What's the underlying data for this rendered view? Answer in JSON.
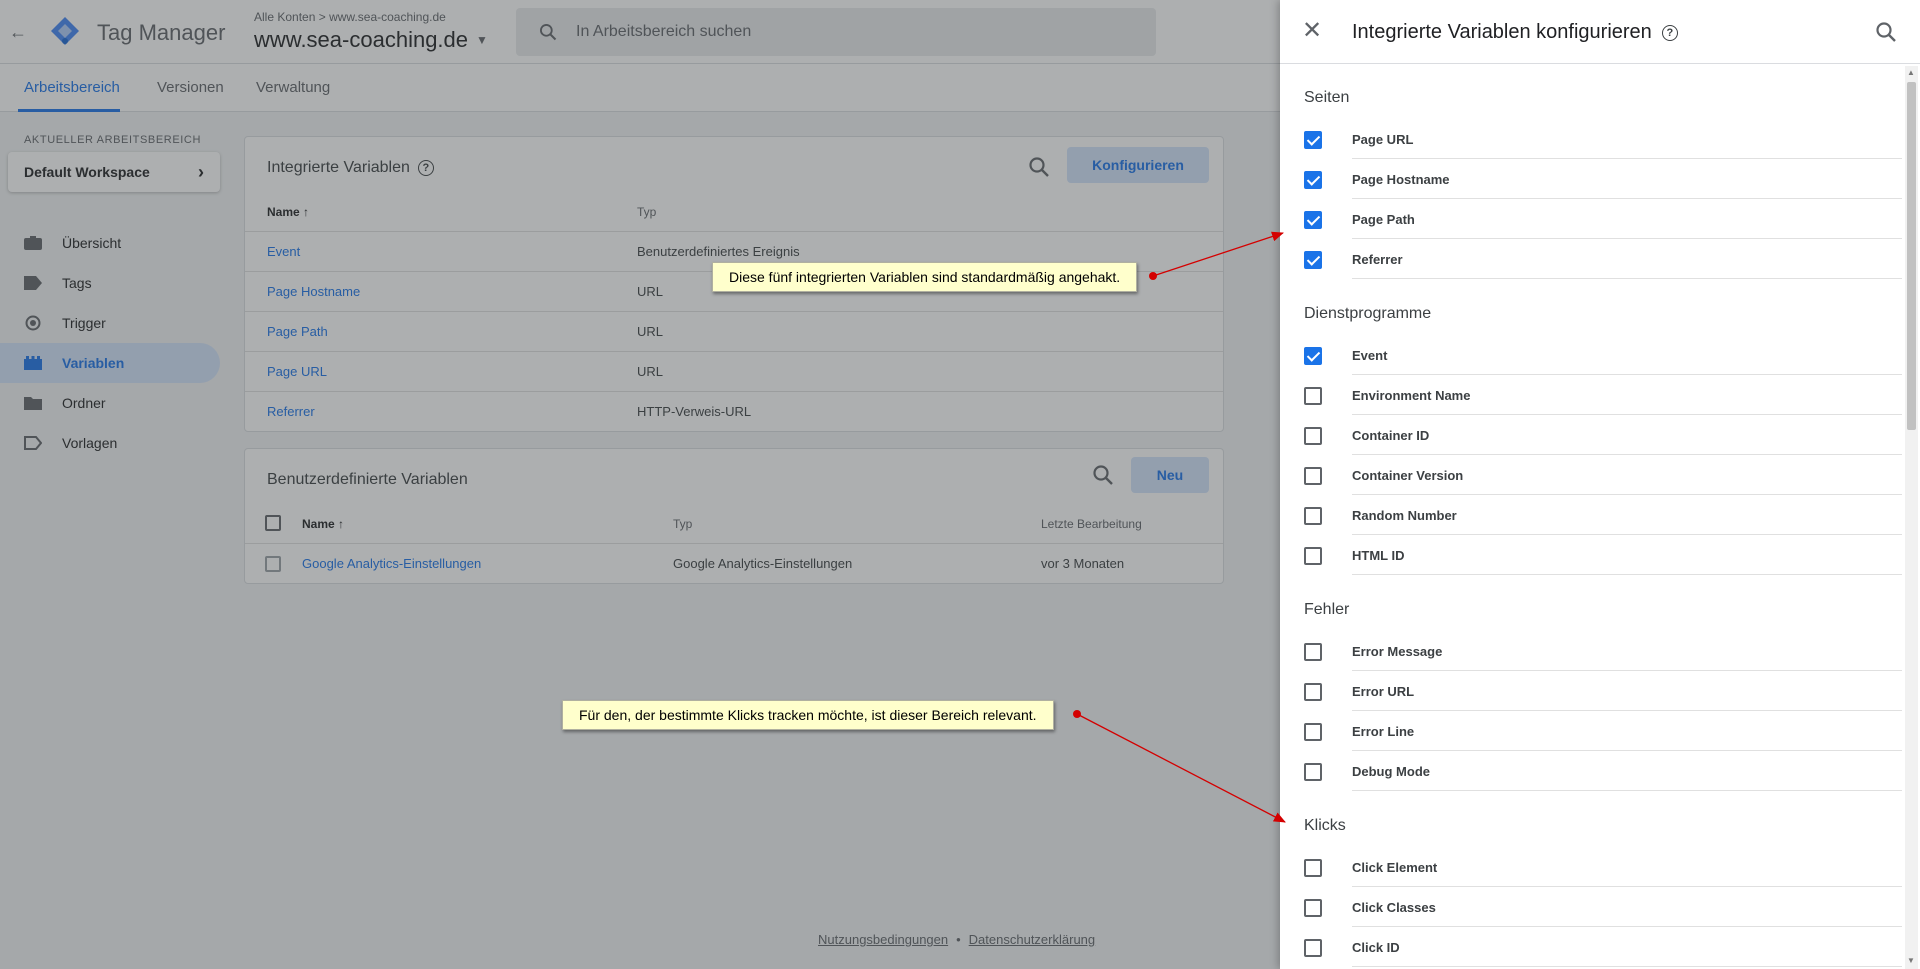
{
  "app": {
    "product": "Tag Manager",
    "breadcrumb_account": "Alle Konten",
    "breadcrumb_sep": ">",
    "breadcrumb_container": "www.sea-coaching.de",
    "container_name": "www.sea-coaching.de",
    "search_placeholder": "In Arbeitsbereich suchen"
  },
  "tabs": [
    "Arbeitsbereich",
    "Versionen",
    "Verwaltung"
  ],
  "workspace": {
    "label": "AKTUELLER ARBEITSBEREICH",
    "name": "Default Workspace"
  },
  "sidebar": {
    "items": [
      {
        "label": "Übersicht",
        "icon": "briefcase-icon"
      },
      {
        "label": "Tags",
        "icon": "tag-icon"
      },
      {
        "label": "Trigger",
        "icon": "trigger-icon"
      },
      {
        "label": "Variablen",
        "icon": "variables-icon",
        "active": true
      },
      {
        "label": "Ordner",
        "icon": "folder-icon"
      },
      {
        "label": "Vorlagen",
        "icon": "template-icon"
      }
    ]
  },
  "builtin": {
    "title": "Integrierte Variablen",
    "configure_label": "Konfigurieren",
    "col_name": "Name",
    "col_type": "Typ",
    "rows": [
      {
        "name": "Event",
        "type": "Benutzerdefiniertes Ereignis"
      },
      {
        "name": "Page Hostname",
        "type": "URL"
      },
      {
        "name": "Page Path",
        "type": "URL"
      },
      {
        "name": "Page URL",
        "type": "URL"
      },
      {
        "name": "Referrer",
        "type": "HTTP-Verweis-URL"
      }
    ]
  },
  "custom": {
    "title": "Benutzerdefinierte Variablen",
    "new_label": "Neu",
    "col_name": "Name",
    "col_type": "Typ",
    "col_edit": "Letzte Bearbeitung",
    "rows": [
      {
        "name": "Google Analytics-Einstellungen",
        "type": "Google Analytics-Einstellungen",
        "edited": "vor 3 Monaten"
      }
    ]
  },
  "footer": {
    "terms": "Nutzungsbedingungen",
    "sep": "•",
    "privacy": "Datenschutzerklärung"
  },
  "panel": {
    "title": "Integrierte Variablen konfigurieren",
    "sections": [
      {
        "title": "Seiten",
        "options": [
          {
            "label": "Page URL",
            "checked": true
          },
          {
            "label": "Page Hostname",
            "checked": true
          },
          {
            "label": "Page Path",
            "checked": true
          },
          {
            "label": "Referrer",
            "checked": true
          }
        ]
      },
      {
        "title": "Dienstprogramme",
        "options": [
          {
            "label": "Event",
            "checked": true
          },
          {
            "label": "Environment Name",
            "checked": false
          },
          {
            "label": "Container ID",
            "checked": false
          },
          {
            "label": "Container Version",
            "checked": false
          },
          {
            "label": "Random Number",
            "checked": false
          },
          {
            "label": "HTML ID",
            "checked": false
          }
        ]
      },
      {
        "title": "Fehler",
        "options": [
          {
            "label": "Error Message",
            "checked": false
          },
          {
            "label": "Error URL",
            "checked": false
          },
          {
            "label": "Error Line",
            "checked": false
          },
          {
            "label": "Debug Mode",
            "checked": false
          }
        ]
      },
      {
        "title": "Klicks",
        "options": [
          {
            "label": "Click Element",
            "checked": false
          },
          {
            "label": "Click Classes",
            "checked": false
          },
          {
            "label": "Click ID",
            "checked": false
          }
        ]
      }
    ]
  },
  "annotations": {
    "note1": "Diese fünf integrierten Variablen sind standardmäßig angehakt.",
    "note2": "Für den, der bestimmte Klicks tracken möchte, ist dieser Bereich relevant."
  },
  "colors": {
    "accent": "#1a73e8",
    "accent_light": "#d2e3fc",
    "note_bg": "#ffffcc",
    "arrow": "#d40000"
  }
}
